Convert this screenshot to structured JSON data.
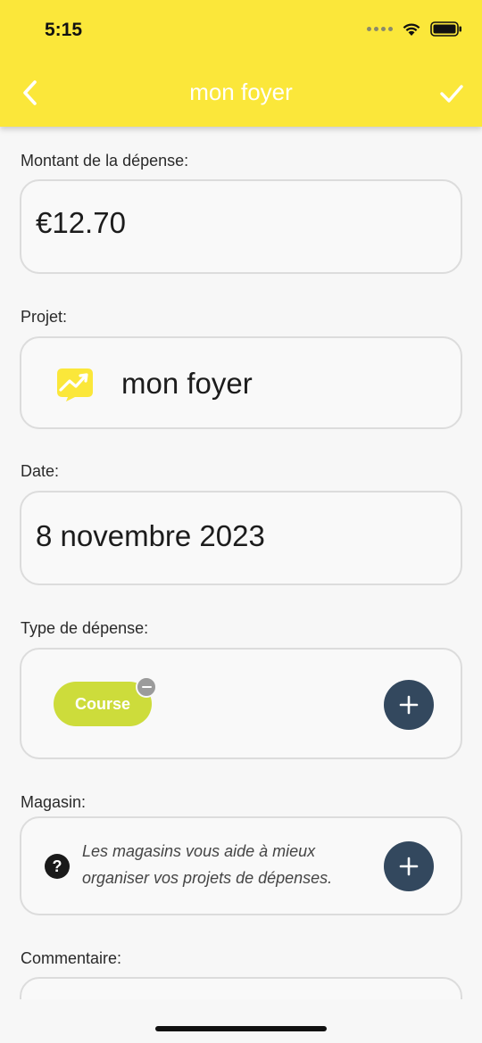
{
  "status_bar": {
    "time": "5:15"
  },
  "nav": {
    "title": "mon foyer",
    "back_icon": "chevron-left-icon",
    "confirm_icon": "checkmark-icon"
  },
  "form": {
    "amount": {
      "label": "Montant de la dépense:",
      "value": "€12.70"
    },
    "project": {
      "label": "Projet:",
      "value": "mon foyer",
      "icon": "trend-chart-icon"
    },
    "date": {
      "label": "Date:",
      "value": "8 novembre 2023"
    },
    "expense_type": {
      "label": "Type de dépense:",
      "tags": [
        "Course"
      ]
    },
    "store": {
      "label": "Magasin:",
      "help_text": "Les magasins vous aide à mieux organiser vos projets de dépenses."
    },
    "comment": {
      "label": "Commentaire:"
    }
  },
  "colors": {
    "header": "#fbe73a",
    "chip": "#cddc3b",
    "add_button": "#33485e"
  }
}
